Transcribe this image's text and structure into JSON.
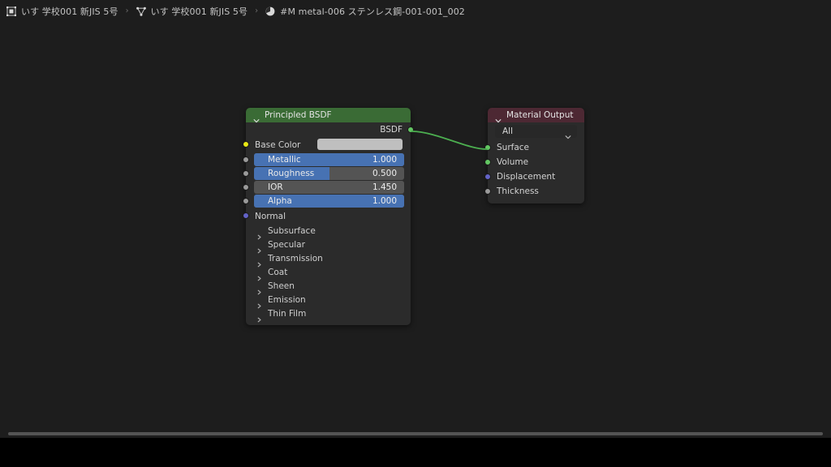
{
  "breadcrumb": {
    "items": [
      {
        "icon": "object-editor-icon",
        "label": "いす 学校001 新JIS 5号"
      },
      {
        "icon": "mesh-data-icon",
        "label": "いす 学校001 新JIS 5号"
      },
      {
        "icon": "material-sphere-icon",
        "label": "#M metal-006 ステンレス鋼-001-001_002"
      }
    ],
    "separator": "›"
  },
  "nodes": {
    "bsdf": {
      "title": "Principled BSDF",
      "header_color": "#3a6b35",
      "collapse_icon": "chevron-down-icon",
      "outputs": [
        {
          "name": "BSDF",
          "socket_color": "#63c763"
        }
      ],
      "color_input": {
        "label": "Base Color",
        "socket_color": "#e8e815",
        "swatch_color": "#bfbfbf"
      },
      "sliders": [
        {
          "label": "Metallic",
          "value": "1.000",
          "fill_percent": 100,
          "socket_color": "#9a9a9a"
        },
        {
          "label": "Roughness",
          "value": "0.500",
          "fill_percent": 50,
          "socket_color": "#9a9a9a"
        },
        {
          "label": "IOR",
          "value": "1.450",
          "fill_percent": 0,
          "socket_color": "#9a9a9a"
        },
        {
          "label": "Alpha",
          "value": "1.000",
          "fill_percent": 100,
          "socket_color": "#9a9a9a"
        }
      ],
      "vector_input": {
        "label": "Normal",
        "socket_color": "#6363c7"
      },
      "panels": [
        {
          "label": "Subsurface",
          "icon": "chevron-right-icon"
        },
        {
          "label": "Specular",
          "icon": "chevron-right-icon"
        },
        {
          "label": "Transmission",
          "icon": "chevron-right-icon"
        },
        {
          "label": "Coat",
          "icon": "chevron-right-icon"
        },
        {
          "label": "Sheen",
          "icon": "chevron-right-icon"
        },
        {
          "label": "Emission",
          "icon": "chevron-right-icon"
        },
        {
          "label": "Thin Film",
          "icon": "chevron-right-icon"
        }
      ]
    },
    "output": {
      "title": "Material Output",
      "header_color": "#4d2833",
      "collapse_icon": "chevron-down-icon",
      "target_dropdown": {
        "value": "All",
        "icon": "chevron-down-icon"
      },
      "inputs": [
        {
          "label": "Surface",
          "socket_color": "#63c763"
        },
        {
          "label": "Volume",
          "socket_color": "#63c763"
        },
        {
          "label": "Displacement",
          "socket_color": "#6363c7"
        },
        {
          "label": "Thickness",
          "socket_color": "#9a9a9a"
        }
      ]
    }
  },
  "link": {
    "from": "BSDF",
    "to": "Surface",
    "color": "#4caf50"
  },
  "canvas": {
    "background": "#1d1d1d"
  }
}
